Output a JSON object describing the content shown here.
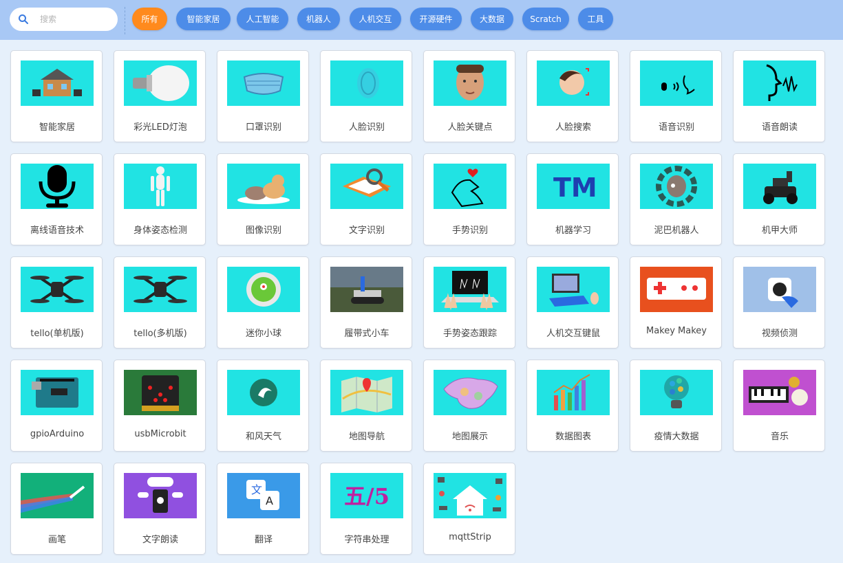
{
  "search": {
    "placeholder": "搜索"
  },
  "tags": [
    {
      "label": "所有",
      "active": true
    },
    {
      "label": "智能家居"
    },
    {
      "label": "人工智能"
    },
    {
      "label": "机器人"
    },
    {
      "label": "人机交互"
    },
    {
      "label": "开源硬件"
    },
    {
      "label": "大数据"
    },
    {
      "label": "Scratch"
    },
    {
      "label": "工具"
    }
  ],
  "extensions": [
    {
      "label": "智能家居",
      "icon": "smart-home-icon"
    },
    {
      "label": "彩光LED灯泡",
      "icon": "led-bulb-icon"
    },
    {
      "label": "口罩识别",
      "icon": "face-mask-icon"
    },
    {
      "label": "人脸识别",
      "icon": "face-recognition-icon"
    },
    {
      "label": "人脸关键点",
      "icon": "face-keypoints-icon"
    },
    {
      "label": "人脸搜索",
      "icon": "face-search-icon"
    },
    {
      "label": "语音识别",
      "icon": "speech-recognition-icon"
    },
    {
      "label": "语音朗读",
      "icon": "speech-reading-icon"
    },
    {
      "label": "离线语音技术",
      "icon": "microphone-icon"
    },
    {
      "label": "身体姿态检测",
      "icon": "body-pose-icon"
    },
    {
      "label": "图像识别",
      "icon": "image-recognition-icon"
    },
    {
      "label": "文字识别",
      "icon": "text-recognition-icon"
    },
    {
      "label": "手势识别",
      "icon": "hand-gesture-icon"
    },
    {
      "label": "机器学习",
      "icon": "machine-learning-icon"
    },
    {
      "label": "泥巴机器人",
      "icon": "mud-robot-icon"
    },
    {
      "label": "机甲大师",
      "icon": "robomaster-icon"
    },
    {
      "label": "tello(单机版)",
      "icon": "drone-icon"
    },
    {
      "label": "tello(多机版)",
      "icon": "drone-icon"
    },
    {
      "label": "迷你小球",
      "icon": "sphero-ball-icon"
    },
    {
      "label": "履带式小车",
      "icon": "tracked-car-icon"
    },
    {
      "label": "手势姿态跟踪",
      "icon": "hand-tracking-icon"
    },
    {
      "label": "人机交互键鼠",
      "icon": "keyboard-mouse-icon"
    },
    {
      "label": "Makey Makey",
      "icon": "makey-makey-icon"
    },
    {
      "label": "视频侦测",
      "icon": "video-sensing-icon"
    },
    {
      "label": "gpioArduino",
      "icon": "arduino-board-icon"
    },
    {
      "label": "usbMicrobit",
      "icon": "microbit-icon"
    },
    {
      "label": "和风天气",
      "icon": "weather-icon"
    },
    {
      "label": "地图导航",
      "icon": "map-navigation-icon"
    },
    {
      "label": "地图展示",
      "icon": "china-map-icon"
    },
    {
      "label": "数据图表",
      "icon": "bar-chart-icon"
    },
    {
      "label": "疫情大数据",
      "icon": "data-bulb-icon"
    },
    {
      "label": "音乐",
      "icon": "music-icon"
    },
    {
      "label": "画笔",
      "icon": "pen-icon"
    },
    {
      "label": "文字朗读",
      "icon": "text-to-speech-icon"
    },
    {
      "label": "翻译",
      "icon": "translate-icon"
    },
    {
      "label": "字符串处理",
      "icon": "string-icon"
    },
    {
      "label": "mqttStrip",
      "icon": "mqtt-home-icon"
    }
  ],
  "string_thumb_text": "五/5",
  "colors": {
    "topbar": "#a8c8f5",
    "tag": "#4d8ce8",
    "tag_active": "#ff8a1d",
    "thumb": "#21e3e3",
    "background": "#e6f0fb"
  }
}
